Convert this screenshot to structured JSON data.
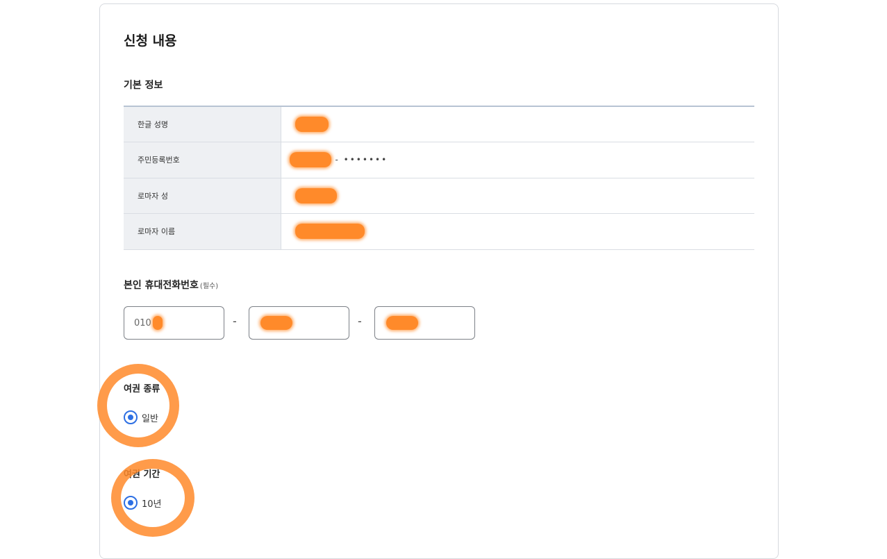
{
  "form": {
    "title": "신청 내용",
    "basic_section": "기본 정보",
    "rows": [
      {
        "label": "한글 성명",
        "value": ""
      },
      {
        "label": "주민등록번호",
        "value": "- •••••••"
      },
      {
        "label": "로마자 성",
        "value": ""
      },
      {
        "label": "로마자 이름",
        "value": ""
      }
    ],
    "phone": {
      "label": "본인 휴대전화번호",
      "required": "(필수)",
      "part1": "010",
      "part2": "",
      "part3": "",
      "separator": "-"
    },
    "passport_type": {
      "label": "여권 종류",
      "option": "일반"
    },
    "validity": {
      "label": "여권 기간",
      "option": "10년"
    }
  },
  "colors": {
    "accent": "#2d6fe3",
    "redaction": "#ff8a2a",
    "table_header_bg": "#eef0f3"
  }
}
